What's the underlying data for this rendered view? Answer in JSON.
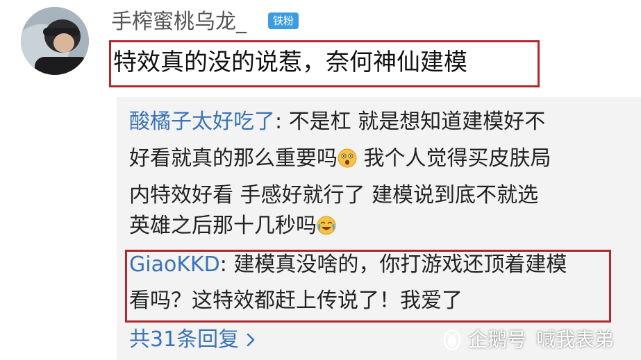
{
  "user": {
    "name": "手榨蜜桃乌龙_",
    "badge": "铁粉",
    "avatar": "user-avatar"
  },
  "comment": {
    "text": "特效真的没的说惹，奈何神仙建模"
  },
  "replies": [
    {
      "author": "酸橘子太好吃了",
      "lines": [
        "不是杠 就是想知道建模好不",
        "好看就真的那么重要吗",
        "我个人觉得买皮肤局",
        "内特效好看 手感好就行了 建模说到底不就选",
        "英雄之后那十几秒吗"
      ]
    },
    {
      "author": "GiaoKKD",
      "lines": [
        "建模真没啥的，你打游戏还顶着建模",
        "看吗？这特效都赶上传说了！我爱了"
      ]
    }
  ],
  "more_replies": "共31条回复",
  "watermark": {
    "brand": "企鹅号",
    "account": "喊我表弟"
  },
  "colors": {
    "highlight_border": "#b2262c",
    "link_blue": "#3a73b6",
    "badge_bg": "#3b9de0",
    "reply_panel_bg": "#f3f3f3"
  },
  "icons": [
    "surprised-emoji-icon",
    "crying-laughing-emoji-icon",
    "chevron-right-icon",
    "penguin-logo-icon"
  ]
}
